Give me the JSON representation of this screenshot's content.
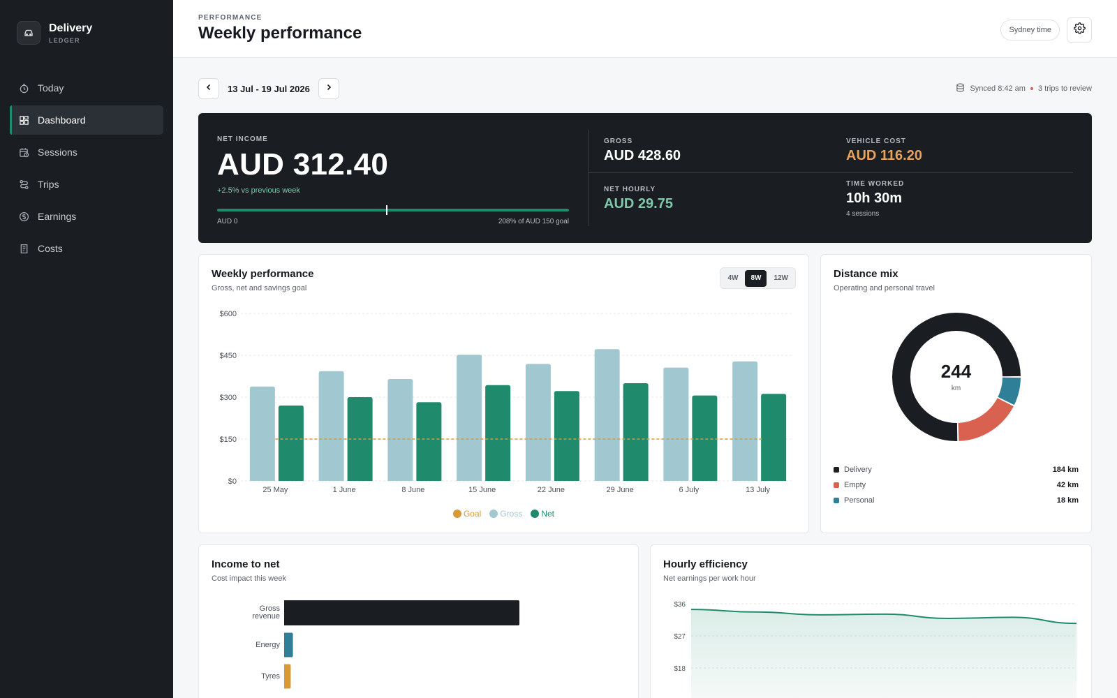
{
  "brand": {
    "name": "Delivery",
    "sub": "LEDGER"
  },
  "nav": [
    {
      "label": "Today",
      "icon": "stopwatch-icon"
    },
    {
      "label": "Dashboard",
      "icon": "dashboard-grid-icon",
      "active": true
    },
    {
      "label": "Sessions",
      "icon": "calendar-clock-icon"
    },
    {
      "label": "Trips",
      "icon": "route-icon"
    },
    {
      "label": "Earnings",
      "icon": "dollar-coin-icon"
    },
    {
      "label": "Costs",
      "icon": "receipt-icon"
    }
  ],
  "header": {
    "eyebrow": "PERFORMANCE",
    "title": "Weekly performance",
    "timezone": "Sydney time"
  },
  "date_range": "13 Jul - 19 Jul 2026",
  "sync": {
    "text": "Synced 8:42 am",
    "review": "3 trips to review"
  },
  "hero": {
    "net_label": "NET INCOME",
    "net_value": "AUD 312.40",
    "net_change": "+2.5% vs previous week",
    "goal_start": "AUD 0",
    "goal_end": "208% of AUD 150 goal",
    "goal_marker_fraction": 0.48,
    "gross_label": "GROSS",
    "gross_value": "AUD 428.60",
    "vehicle_label": "VEHICLE COST",
    "vehicle_value": "AUD 116.20",
    "hourly_label": "NET HOURLY",
    "hourly_value": "AUD 29.75",
    "time_label": "TIME WORKED",
    "time_value": "10h 30m",
    "time_sub": "4 sessions"
  },
  "weekly": {
    "title": "Weekly performance",
    "subtitle": "Gross, net and savings goal",
    "ranges": [
      "4W",
      "8W",
      "12W"
    ],
    "active_range": "8W",
    "legend": {
      "goal": "Goal",
      "gross": "Gross",
      "net": "Net"
    }
  },
  "distance": {
    "title": "Distance mix",
    "subtitle": "Operating and personal travel",
    "total": "244",
    "unit": "km",
    "items": [
      {
        "label": "Delivery",
        "value": "184 km",
        "km": 184,
        "color": "#1a1d21"
      },
      {
        "label": "Empty",
        "value": "42 km",
        "km": 42,
        "color": "#d9614f"
      },
      {
        "label": "Personal",
        "value": "18 km",
        "km": 18,
        "color": "#2f7f99"
      }
    ]
  },
  "income_to_net": {
    "title": "Income to net",
    "subtitle": "Cost impact this week"
  },
  "hourly": {
    "title": "Hourly efficiency",
    "subtitle": "Net earnings per work hour"
  },
  "colors": {
    "accent": "#1f8b6c",
    "gross": "#a1c7d1",
    "goal": "#d99a35",
    "dark": "#1a1d21",
    "warm": "#e8a25a",
    "mint": "#7fc8a9"
  },
  "chart_data": [
    {
      "type": "bar",
      "categories": [
        "25 May",
        "1 June",
        "8 June",
        "15 June",
        "22 June",
        "29 June",
        "6 July",
        "13 July"
      ],
      "series": [
        {
          "name": "Gross",
          "values": [
            338,
            393,
            365,
            452,
            419,
            472,
            406,
            428
          ],
          "color": "#a1c7d1"
        },
        {
          "name": "Net",
          "values": [
            270,
            300,
            282,
            343,
            322,
            350,
            306,
            312
          ],
          "color": "#1f8b6c"
        }
      ],
      "goal": {
        "name": "Goal",
        "value": 150,
        "color": "#d99a35"
      },
      "ylim": [
        0,
        600
      ],
      "yticks": [
        "$0",
        "$150",
        "$300",
        "$450",
        "$600"
      ],
      "ytick_values": [
        0,
        150,
        300,
        450,
        600
      ],
      "grid": true,
      "legend": "bottom"
    },
    {
      "type": "pie",
      "categories": [
        "Delivery",
        "Empty",
        "Personal"
      ],
      "values": [
        184,
        42,
        18
      ]
    },
    {
      "type": "bar",
      "orientation": "horizontal",
      "categories": [
        "Gross revenue",
        "Energy",
        "Tyres"
      ],
      "values": [
        428.6,
        16,
        12
      ],
      "colors": [
        "#1a1d21",
        "#2f7f99",
        "#d99a35"
      ]
    },
    {
      "type": "area",
      "y": [
        34.4,
        33.7,
        32.9,
        33.1,
        31.9,
        32.2,
        30.5
      ],
      "ylim": [
        9,
        36
      ],
      "yticks": [
        "$36",
        "$27",
        "$18"
      ],
      "ytick_values": [
        36,
        27,
        18
      ],
      "grid": true
    }
  ]
}
